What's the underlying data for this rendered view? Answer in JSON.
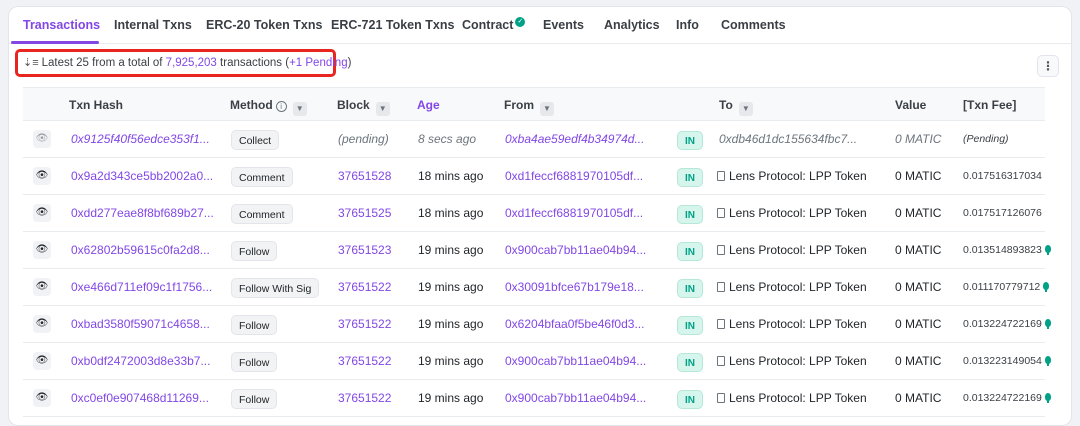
{
  "tabs": [
    {
      "label": "Transactions",
      "active": true
    },
    {
      "label": "Internal Txns"
    },
    {
      "label": "ERC-20 Token Txns"
    },
    {
      "label": "ERC-721 Token Txns"
    },
    {
      "label": "Contract",
      "verified": true
    },
    {
      "label": "Events"
    },
    {
      "label": "Analytics"
    },
    {
      "label": "Info"
    },
    {
      "label": "Comments"
    }
  ],
  "summary": {
    "prefix": "Latest 25 from a total of",
    "total": "7,925,203",
    "middle": "transactions (",
    "pending": "+1 Pending",
    "suffix": ")"
  },
  "more_button": "⋮",
  "columns": {
    "txn_hash": "Txn Hash",
    "method": "Method",
    "block": "Block",
    "age": "Age",
    "from": "From",
    "to": "To",
    "value": "Value",
    "txn_fee": "[Txn Fee]"
  },
  "rows": [
    {
      "hash": "0x9125f40f56edce353f1...",
      "method": "Collect",
      "block": "(pending)",
      "age": "8 secs ago",
      "from": "0xba4ae59edf4b34974d...",
      "direction": "IN",
      "to": "0xdb46d1dc155634fbc7...",
      "value": "0 MATIC",
      "fee": "(Pending)",
      "pending": true
    },
    {
      "hash": "0x9a2d343ce5bb2002a0...",
      "method": "Comment",
      "block": "37651528",
      "age": "18 mins ago",
      "from": "0xd1feccf6881970105df...",
      "direction": "IN",
      "to": "Lens Protocol: LPP Token",
      "value": "0 MATIC",
      "fee": "0.017516317034",
      "gas": false
    },
    {
      "hash": "0xdd277eae8f8bf689b27...",
      "method": "Comment",
      "block": "37651525",
      "age": "18 mins ago",
      "from": "0xd1feccf6881970105df...",
      "direction": "IN",
      "to": "Lens Protocol: LPP Token",
      "value": "0 MATIC",
      "fee": "0.017517126076",
      "gas": false
    },
    {
      "hash": "0x62802b59615c0fa2d8...",
      "method": "Follow",
      "block": "37651523",
      "age": "19 mins ago",
      "from": "0x900cab7bb11ae04b94...",
      "direction": "IN",
      "to": "Lens Protocol: LPP Token",
      "value": "0 MATIC",
      "fee": "0.013514893823",
      "gas": true
    },
    {
      "hash": "0xe466d711ef09c1f1756...",
      "method": "Follow With Sig",
      "block": "37651522",
      "age": "19 mins ago",
      "from": "0x30091bfce67b179e18...",
      "direction": "IN",
      "to": "Lens Protocol: LPP Token",
      "value": "0 MATIC",
      "fee": "0.011170779712",
      "gas": true
    },
    {
      "hash": "0xbad3580f59071c4658...",
      "method": "Follow",
      "block": "37651522",
      "age": "19 mins ago",
      "from": "0x6204bfaa0f5be46f0d3...",
      "direction": "IN",
      "to": "Lens Protocol: LPP Token",
      "value": "0 MATIC",
      "fee": "0.013224722169",
      "gas": true
    },
    {
      "hash": "0xb0df2472003d8e33b7...",
      "method": "Follow",
      "block": "37651522",
      "age": "19 mins ago",
      "from": "0x900cab7bb11ae04b94...",
      "direction": "IN",
      "to": "Lens Protocol: LPP Token",
      "value": "0 MATIC",
      "fee": "0.013223149054",
      "gas": true
    },
    {
      "hash": "0xc0ef0e907468d11269...",
      "method": "Follow",
      "block": "37651522",
      "age": "19 mins ago",
      "from": "0x900cab7bb11ae04b94...",
      "direction": "IN",
      "to": "Lens Protocol: LPP Token",
      "value": "0 MATIC",
      "fee": "0.013224722169",
      "gas": true
    }
  ],
  "colors": {
    "accent": "#8247e5",
    "in_badge": "#00a186",
    "highlight": "#e8251f"
  }
}
